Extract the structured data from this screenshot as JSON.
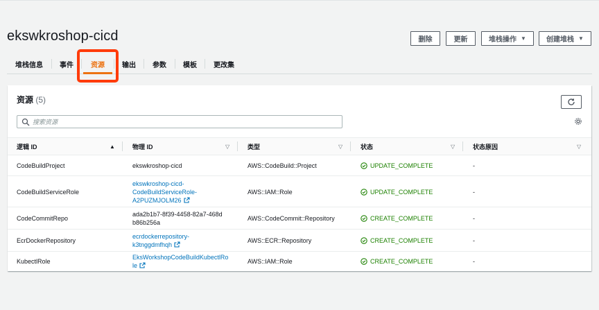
{
  "page": {
    "title": "ekswkroshop-cicd"
  },
  "actions": {
    "delete": "删除",
    "update": "更新",
    "stack_actions": "堆栈操作",
    "create_stack": "创建堆栈"
  },
  "tabs": [
    {
      "label": "堆栈信息"
    },
    {
      "label": "事件"
    },
    {
      "label": "资源"
    },
    {
      "label": "输出"
    },
    {
      "label": "参数"
    },
    {
      "label": "模板"
    },
    {
      "label": "更改集"
    }
  ],
  "resources": {
    "title": "资源",
    "count": "(5)",
    "search_placeholder": "搜索资源",
    "columns": [
      "逻辑 ID",
      "物理 ID",
      "类型",
      "状态",
      "状态原因"
    ],
    "rows": [
      {
        "logical_id": "CodeBuildProject",
        "physical_id": [
          "ekswkroshop-cicd"
        ],
        "physical_link": false,
        "type": "AWS::CodeBuild::Project",
        "status": "UPDATE_COMPLETE",
        "reason": "-"
      },
      {
        "logical_id": "CodeBuildServiceRole",
        "physical_id": [
          "ekswkroshop-cicd-",
          "CodeBuildServiceRole-",
          "A2PUZMJOLM26"
        ],
        "physical_link": true,
        "type": "AWS::IAM::Role",
        "status": "UPDATE_COMPLETE",
        "reason": "-"
      },
      {
        "logical_id": "CodeCommitRepo",
        "physical_id": [
          "ada2b1b7-8f39-4458-82a7-468d",
          "b86b256a"
        ],
        "physical_link": false,
        "type": "AWS::CodeCommit::Repository",
        "status": "CREATE_COMPLETE",
        "reason": "-"
      },
      {
        "logical_id": "EcrDockerRepository",
        "physical_id": [
          "ecrdockerrepository-",
          "k3tnggdmfhqh"
        ],
        "physical_link": true,
        "type": "AWS::ECR::Repository",
        "status": "CREATE_COMPLETE",
        "reason": "-"
      },
      {
        "logical_id": "KubectlRole",
        "physical_id": [
          "EksWorkshopCodeBuildKubectlRo",
          "le"
        ],
        "physical_link": true,
        "type": "AWS::IAM::Role",
        "status": "CREATE_COMPLETE",
        "reason": "-"
      }
    ]
  },
  "colors": {
    "accent": "#ec7211",
    "link": "#0073bb",
    "success": "#1d8102",
    "highlight": "#ff3b0a"
  },
  "icons": [
    "search-icon",
    "refresh-icon",
    "settings-gear-icon",
    "external-link-icon",
    "success-check-icon",
    "sort-caret-icon"
  ]
}
